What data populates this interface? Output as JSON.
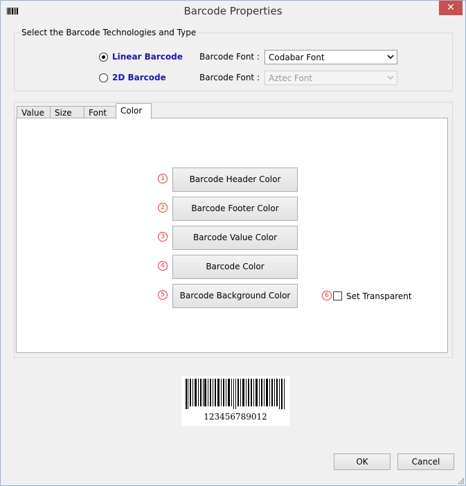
{
  "window": {
    "title": "Barcode Properties",
    "close_symbol": "✕"
  },
  "technology_group": {
    "legend": "Select the Barcode Technologies and Type",
    "options": [
      {
        "label": "Linear Barcode",
        "checked": true,
        "font_label": "Barcode Font :",
        "font_value": "Codabar Font",
        "enabled": true
      },
      {
        "label": "2D Barcode",
        "checked": false,
        "font_label": "Barcode Font :",
        "font_value": "Aztec Font",
        "enabled": false
      }
    ]
  },
  "tabs": [
    {
      "label": "Value",
      "active": false
    },
    {
      "label": "Size",
      "active": false
    },
    {
      "label": "Font",
      "active": false
    },
    {
      "label": "Color",
      "active": true
    }
  ],
  "color_panel": {
    "buttons": [
      {
        "number": "1",
        "label": "Barcode Header Color"
      },
      {
        "number": "2",
        "label": "Barcode Footer Color"
      },
      {
        "number": "3",
        "label": "Barcode Value Color"
      },
      {
        "number": "4",
        "label": "Barcode Color"
      },
      {
        "number": "5",
        "label": "Barcode Background Color"
      }
    ],
    "transparent": {
      "number": "6",
      "label": "Set Transparent",
      "checked": false
    }
  },
  "preview": {
    "value_text": "123456789012"
  },
  "footer": {
    "ok_label": "OK",
    "cancel_label": "Cancel"
  },
  "colors": {
    "accent_label": "#1a1ab0",
    "marker": "#e33333",
    "close": "#c75050"
  },
  "icons": {
    "app": "barcode-icon",
    "close": "close-icon",
    "dropdown": "chevron-down-icon",
    "grip": "resize-grip-icon"
  }
}
